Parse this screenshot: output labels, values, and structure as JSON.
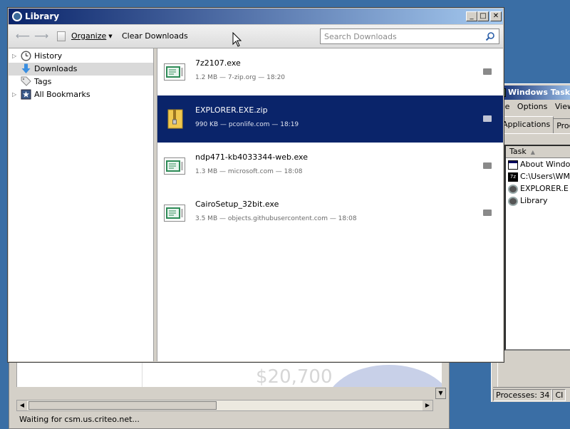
{
  "background_browser": {
    "price_text": "$20,700",
    "status_text": "Waiting for csm.us.criteo.net..."
  },
  "task_manager": {
    "title": "Windows Task M",
    "menu": [
      "File",
      "Options",
      "View"
    ],
    "tabs": [
      "Applications",
      "Proce"
    ],
    "list_header": "Task",
    "tasks": [
      {
        "name": "About Windo",
        "icon": "window-icon"
      },
      {
        "name": "C:\\Users\\WM",
        "icon": "cmd-icon"
      },
      {
        "name": "EXPLORER.E",
        "icon": "firefox-icon"
      },
      {
        "name": "Library",
        "icon": "firefox-icon"
      }
    ],
    "status": {
      "processes": "Processes: 34",
      "cpu": "CI"
    }
  },
  "library": {
    "title": "Library",
    "toolbar": {
      "organize_label": "Organize",
      "clear_label": "Clear Downloads",
      "search_placeholder": "Search Downloads"
    },
    "sidebar": [
      {
        "label": "History",
        "icon": "history-icon",
        "expandable": true,
        "selected": false
      },
      {
        "label": "Downloads",
        "icon": "downloads-icon",
        "expandable": false,
        "selected": true
      },
      {
        "label": "Tags",
        "icon": "tags-icon",
        "expandable": false,
        "selected": false
      },
      {
        "label": "All Bookmarks",
        "icon": "bookmarks-icon",
        "expandable": true,
        "selected": false
      }
    ],
    "downloads": [
      {
        "name": "7z2107.exe",
        "meta": "1.2 MB — 7-zip.org — 18:20",
        "icon": "exe-file-icon",
        "selected": false
      },
      {
        "name": "EXPLORER.EXE.zip",
        "meta": "990 KB — pconlife.com — 18:19",
        "icon": "zip-file-icon",
        "selected": true
      },
      {
        "name": "ndp471-kb4033344-web.exe",
        "meta": "1.3 MB — microsoft.com — 18:08",
        "icon": "exe-file-icon",
        "selected": false
      },
      {
        "name": "CairoSetup_32bit.exe",
        "meta": "3.5 MB — objects.githubusercontent.com — 18:08",
        "icon": "exe-file-icon",
        "selected": false
      }
    ]
  },
  "colors": {
    "desktop": "#3a6ea5",
    "selection": "#0a246a",
    "titlebar_start": "#0a246a",
    "titlebar_end": "#a6caf0"
  }
}
